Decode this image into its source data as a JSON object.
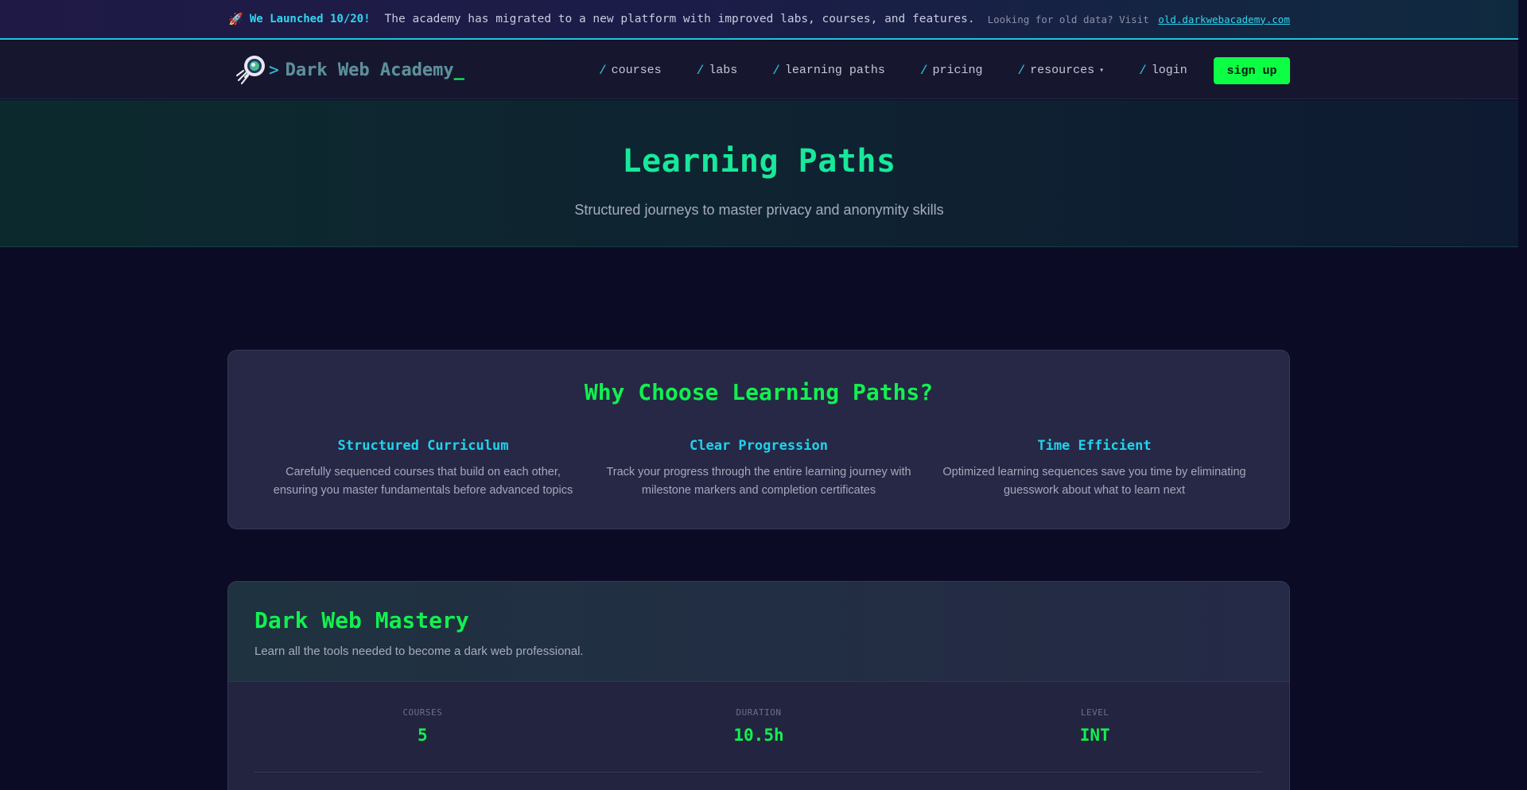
{
  "announcement": {
    "rocket": "🚀",
    "launched": "We Launched 10/20!",
    "message": "The academy has migrated to a new platform with improved labs, courses, and features.",
    "old_prefix": "Looking for old data? Visit",
    "old_link": "old.darkwebacademy.com"
  },
  "nav": {
    "brand_prompt": ">",
    "brand_name": "Dark Web Academy",
    "brand_cursor": "_",
    "slash": "/",
    "links": [
      "courses",
      "labs",
      "learning paths",
      "pricing",
      "resources",
      "login"
    ],
    "resources_caret": "▾",
    "signup": "sign up"
  },
  "hero": {
    "title": "Learning Paths",
    "subtitle": "Structured journeys to master privacy and anonymity skills"
  },
  "why": {
    "title": "Why Choose Learning Paths?",
    "columns": [
      {
        "title": "Structured Curriculum",
        "text": "Carefully sequenced courses that build on each other, ensuring you master fundamentals before advanced topics"
      },
      {
        "title": "Clear Progression",
        "text": "Track your progress through the entire learning journey with milestone markers and completion certificates"
      },
      {
        "title": "Time Efficient",
        "text": "Optimized learning sequences save you time by eliminating guesswork about what to learn next"
      }
    ]
  },
  "path": {
    "title": "Dark Web Mastery",
    "description": "Learn all the tools needed to become a dark web professional.",
    "stats": [
      {
        "label": "COURSES",
        "value": "5"
      },
      {
        "label": "DURATION",
        "value": "10.5h"
      },
      {
        "label": "LEVEL",
        "value": "INT"
      }
    ]
  },
  "colors": {
    "accent_green": "#12f050",
    "accent_cyan": "#2fd7f0",
    "signup_bg": "#0dff45",
    "page_bg": "#0b0b26"
  }
}
